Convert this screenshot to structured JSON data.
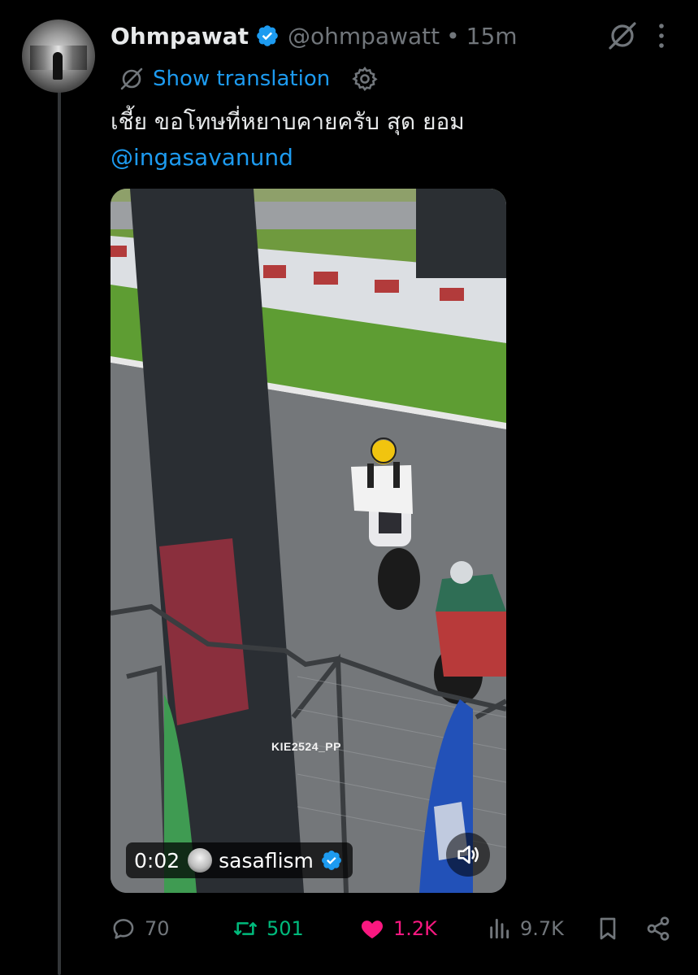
{
  "tweet": {
    "author_name": "Ohmpawat",
    "author_handle": "@ohmpawatt",
    "separator": "•",
    "timestamp": "15m",
    "translate_label": "Show translation",
    "text": "เชี้ย ขอโทษที่หยาบคายครับ สุด ยอม",
    "mention": "@ingasavanund"
  },
  "video": {
    "watermark": "KIE2524_PP",
    "duration": "0:02",
    "source_user": "sasaflism"
  },
  "actions": {
    "replies": "70",
    "retweets": "501",
    "likes": "1.2K",
    "views": "9.7K"
  },
  "icons": {
    "verified": "verified-badge-icon",
    "grok": "grok-icon",
    "more": "more-icon",
    "translate": "globe-icon",
    "settings": "gear-icon",
    "mute": "speaker-icon",
    "reply": "reply-icon",
    "retweet": "retweet-icon",
    "like": "heart-icon",
    "views": "views-icon",
    "bookmark": "bookmark-icon",
    "share": "share-icon"
  },
  "colors": {
    "background": "#000000",
    "text": "#e7e9ea",
    "muted": "#71767b",
    "link": "#1d9bf0",
    "retweet": "#00ba7c",
    "like": "#f91880"
  }
}
